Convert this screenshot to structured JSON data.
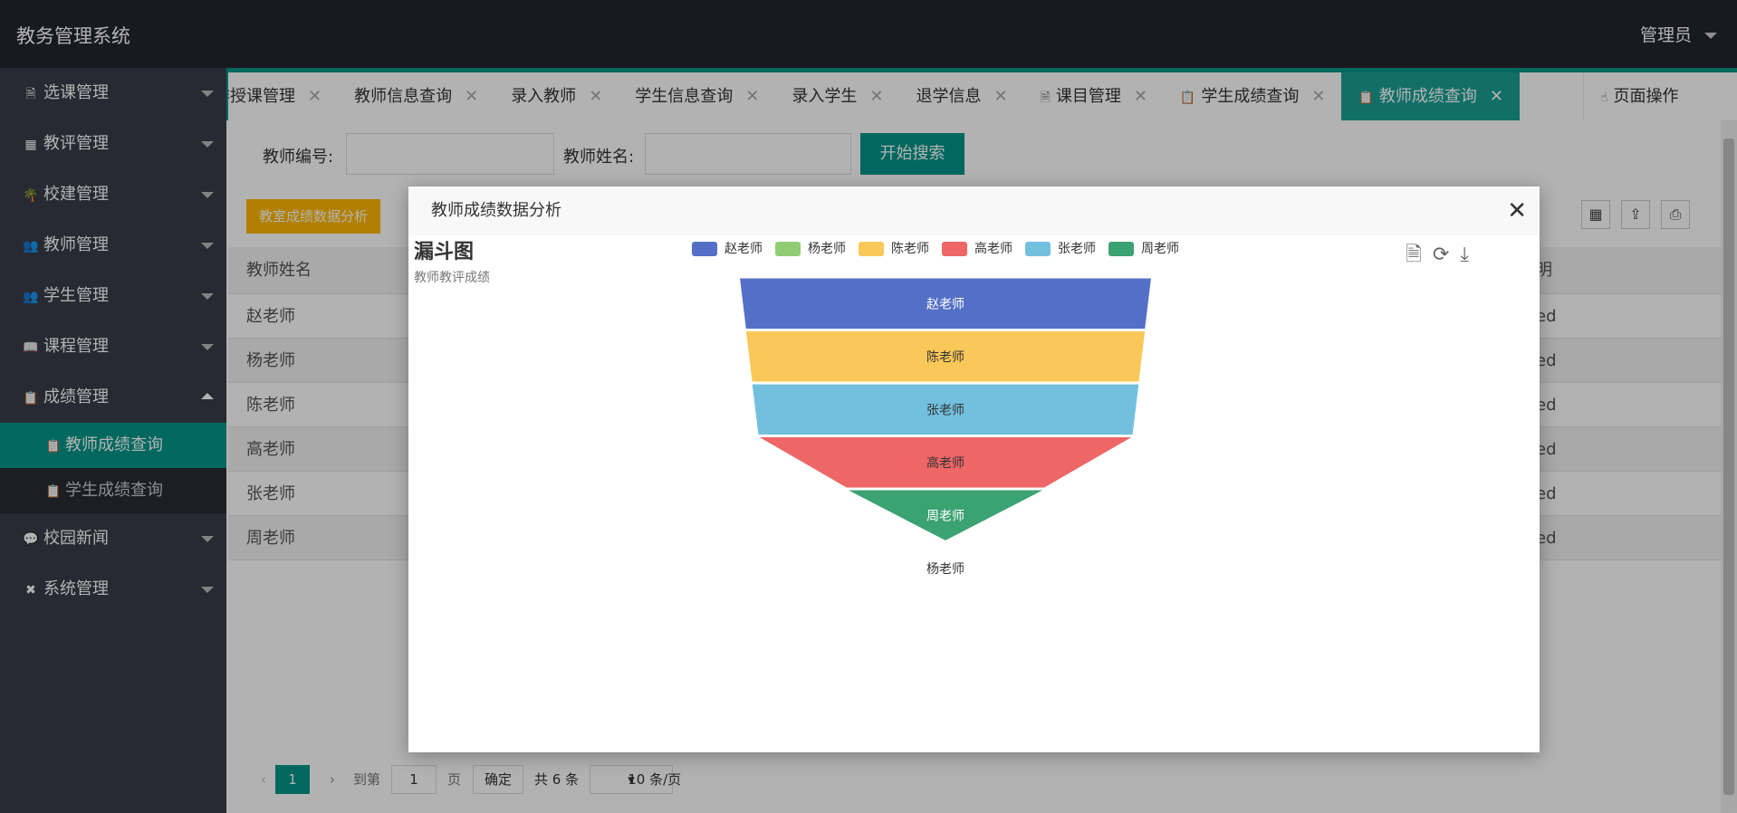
{
  "app": {
    "title": "教务管理系统",
    "user": "管理员"
  },
  "sidebar": {
    "items": [
      {
        "label": "选课管理",
        "icon": "document-icon"
      },
      {
        "label": "教评管理",
        "icon": "grid-icon"
      },
      {
        "label": "校建管理",
        "icon": "palm-icon"
      },
      {
        "label": "教师管理",
        "icon": "users-icon"
      },
      {
        "label": "学生管理",
        "icon": "users-icon"
      },
      {
        "label": "课程管理",
        "icon": "book-icon"
      },
      {
        "label": "成绩管理",
        "icon": "clipboard-icon"
      },
      {
        "label": "校园新闻",
        "icon": "chat-icon"
      },
      {
        "label": "系统管理",
        "icon": "tools-icon"
      }
    ],
    "sub_items": [
      {
        "label": "教师成绩查询",
        "icon": "clipboard-icon",
        "active": true
      },
      {
        "label": "学生成绩查询",
        "icon": "clipboard-icon",
        "active": false
      }
    ]
  },
  "tabs": [
    {
      "label": "排授课管理"
    },
    {
      "label": "教师信息查询"
    },
    {
      "label": "录入教师"
    },
    {
      "label": "学生信息查询"
    },
    {
      "label": "录入学生"
    },
    {
      "label": "退学信息"
    },
    {
      "label": "课目管理"
    },
    {
      "label": "学生成绩查询"
    },
    {
      "label": "教师成绩查询"
    }
  ],
  "page_ops_label": "页面操作",
  "search": {
    "teacher_id_label": "教师编号:",
    "teacher_name_label": "教师姓名:",
    "button": "开始搜索"
  },
  "analysis_button": "教室成绩数据分析",
  "table": {
    "header": "教师姓名",
    "header_right": "明",
    "rows": [
      "赵老师",
      "杨老师",
      "陈老师",
      "高老师",
      "张老师",
      "周老师"
    ],
    "right_fragment": "ed"
  },
  "pager": {
    "current": "1",
    "goto_label": "到第",
    "page_input": "1",
    "page_label": "页",
    "confirm": "确定",
    "total": "共 6 条",
    "page_size": "10 条/页"
  },
  "modal": {
    "title": "教师成绩数据分析"
  },
  "chart_data": {
    "type": "funnel",
    "title": "漏斗图",
    "subtitle": "教师教评成绩",
    "legend": [
      "赵老师",
      "杨老师",
      "陈老师",
      "高老师",
      "张老师",
      "周老师"
    ],
    "colors": {
      "赵老师": "#5470c6",
      "杨老师": "#91cc75",
      "陈老师": "#fac858",
      "高老师": "#ee6666",
      "张老师": "#73c0de",
      "周老师": "#3ba272"
    },
    "order": [
      "赵老师",
      "陈老师",
      "张老师",
      "高老师",
      "周老师",
      "杨老师"
    ],
    "values": [
      100,
      97,
      94,
      91,
      48,
      0
    ]
  }
}
